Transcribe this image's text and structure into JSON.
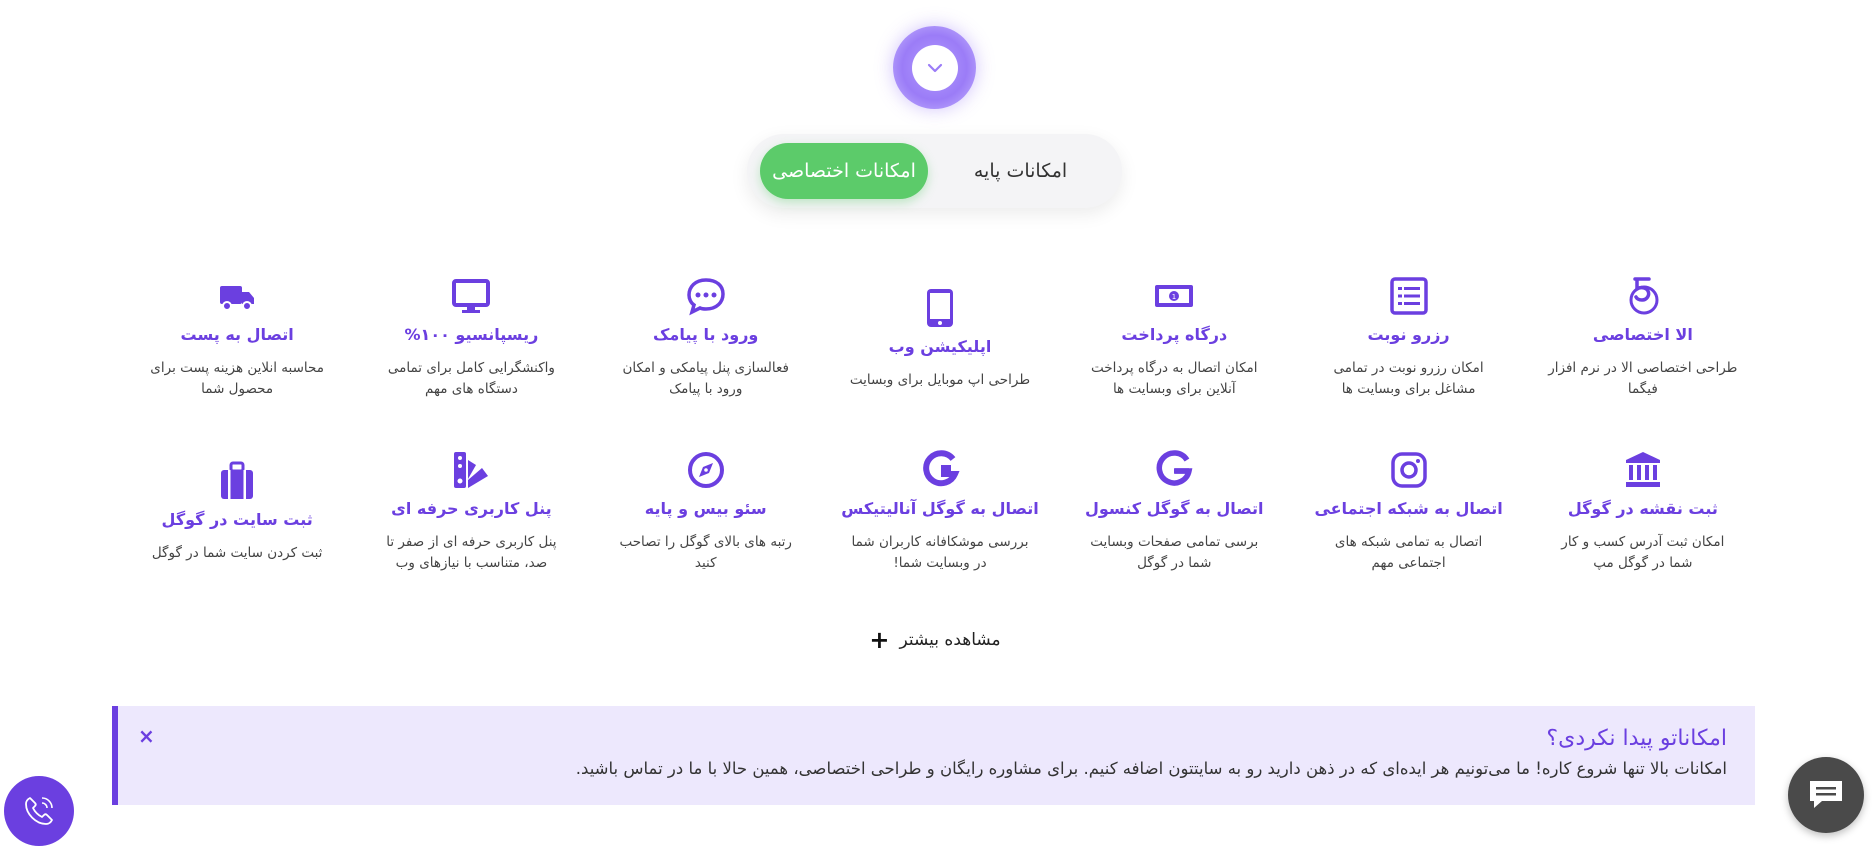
{
  "tabs": {
    "basic": "امکانات پایه",
    "custom": "امکانات اختصاصی"
  },
  "features": [
    {
      "title": "اتصال به پست",
      "desc": "محاسبه انلاین هزینه پست برای محصول شما",
      "icon": "truck-icon"
    },
    {
      "title": "ریسپانسیو ۱۰۰%",
      "desc": "واکنشگرایی کامل برای تمامی دستگاه های مهم",
      "icon": "monitor-icon"
    },
    {
      "title": "ورود با پیامک",
      "desc": "فعالسازی پنل پیامکی و امکان ورود با پیامک",
      "icon": "chat-bubble-icon"
    },
    {
      "title": "اپلیکیشن وب",
      "desc": "طراحی اپ موبایل برای وبسایت",
      "icon": "tablet-icon"
    },
    {
      "title": "درگاه پرداخت",
      "desc": "امکان اتصال به درگاه پرداخت آنلاین برای وبسایت ها",
      "icon": "money-icon"
    },
    {
      "title": "رزرو نوبت",
      "desc": "امکان رزرو نوبت در تمامی مشاغل برای وبسایت ها",
      "icon": "list-icon"
    },
    {
      "title": "الا اختصاصی",
      "desc": "طراحی اختصاصی الا در نرم افزار فیگما",
      "icon": "five-badge-icon"
    },
    {
      "title": "ثبت سایت در گوگل",
      "desc": "ثبت کردن سایت شما در گوگل",
      "icon": "suitcase-icon"
    },
    {
      "title": "پنل کاربری حرفه ای",
      "desc": "پنل کاربری حرفه ای از صفر تا صد، متناسب با نیازهای وب",
      "icon": "palette-icon"
    },
    {
      "title": "سئو بیس و پایه",
      "desc": "رتبه های بالای گوگل را تصاحب کنید",
      "icon": "compass-icon"
    },
    {
      "title": "اتصال به گوگل آنالیتیکس",
      "desc": "بررسی موشکافانه کاربران شما در وبسایت شما!",
      "icon": "google-analytics-icon"
    },
    {
      "title": "اتصال به گوگل کنسول",
      "desc": "برسی تمامی صفحات وبسایت شما در گوگل",
      "icon": "google-icon"
    },
    {
      "title": "اتصال به شبکه اجتماعی",
      "desc": "اتصال به تمامی شبکه های اجتماعی مهم",
      "icon": "instagram-icon"
    },
    {
      "title": "ثبت نقشه در گوگل",
      "desc": "امکان ثبت آدرس کسب و کار شما در گوگل مپ",
      "icon": "bank-icon"
    }
  ],
  "see_more": "مشاهده بیشتر",
  "notice": {
    "title": "امکاناتو پیدا نکردی؟",
    "body": "امکانات بالا تنها شروع کاره! ما می‌تونیم هر ایده‌ای که در ذهن دارید رو به سایتتون اضافه کنیم. برای مشاوره رایگان و طراحی اختصاصی، همین حالا با ما در تماس باشید.",
    "close": "×"
  },
  "colors": {
    "accent": "#6b3fe0",
    "green": "#5ccb6a"
  }
}
